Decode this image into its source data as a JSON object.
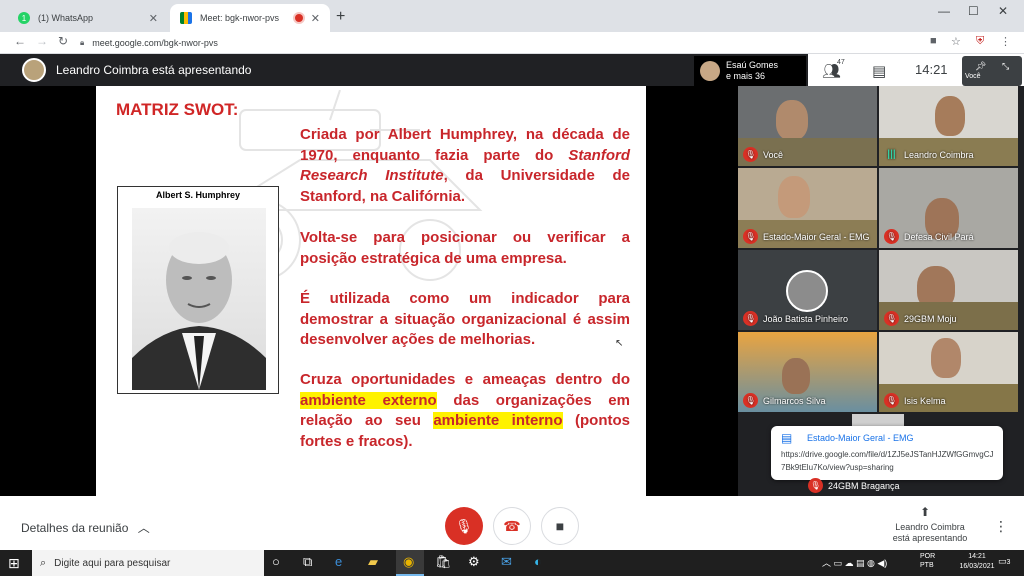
{
  "browser": {
    "tabs": [
      {
        "title": "(1) WhatsApp",
        "badge": "1"
      },
      {
        "title": "Meet: bgk-nwor-pvs"
      }
    ],
    "url": "meet.google.com/bgk-nwor-pvs"
  },
  "meet": {
    "presenter_banner": "Leandro Coimbra está apresentando",
    "people_chip": {
      "name": "Esaú Gomes",
      "more": "e mais 36"
    },
    "participant_count": "47",
    "clock": "14:21",
    "self_label": "Você"
  },
  "slide": {
    "title": "MATRIZ SWOT:",
    "photo_caption": "Albert S. Humphrey",
    "p1_a": "Criada por Albert Humphrey, na década de 1970, enquanto fazia parte do ",
    "p1_em": "Stanford Research Institute",
    "p1_b": ", da Universidade de Stanford, na Califórnia.",
    "p2": "Volta-se para posicionar ou verificar a posição estratégica de uma empresa.",
    "p3": "É utilizada como um indicador para demostrar a situação organizacional é assim desenvolver ações de melhorias.",
    "p4_a": "Cruza oportunidades e ameaças dentro do ",
    "p4_hl1": "ambiente externo",
    "p4_b": " das organizações em relação ao seu ",
    "p4_hl2": "ambiente interno",
    "p4_c": " (pontos fortes e fracos)."
  },
  "participants": [
    {
      "name": "Você",
      "muted": true
    },
    {
      "name": "Leandro Coimbra",
      "muted": false
    },
    {
      "name": "Estado-Maior Geral - EMG",
      "muted": true
    },
    {
      "name": "Defesa Civil Pará",
      "muted": true
    },
    {
      "name": "João Batista Pinheiro",
      "muted": true
    },
    {
      "name": "29GBM Moju",
      "muted": true
    },
    {
      "name": "Gilmarcos Silva",
      "muted": true
    },
    {
      "name": "Isis Kelma",
      "muted": true
    },
    {
      "name": "24GBM Bragança",
      "muted": true
    }
  ],
  "chat": {
    "sender": "Estado-Maior Geral - EMG",
    "message": "https://drive.google.com/file/d/1ZJ5eJSTanHJZWfGGmvgCJ7Bk9tElu7Ko/view?usp=sharing"
  },
  "bottom": {
    "details": "Detalhes da reunião",
    "presenting_1": "Leandro Coimbra",
    "presenting_2": "está apresentando"
  },
  "taskbar": {
    "search_placeholder": "Digite aqui para pesquisar",
    "lang_1": "POR",
    "lang_2": "PTB",
    "time": "14:21",
    "date": "16/03/2021",
    "notifications": "3"
  },
  "colors": {
    "slide_red": "#c8262b",
    "highlight": "#fff200",
    "meet_dark": "#202124",
    "mute_red": "#d93025",
    "link_blue": "#1a73e8"
  }
}
